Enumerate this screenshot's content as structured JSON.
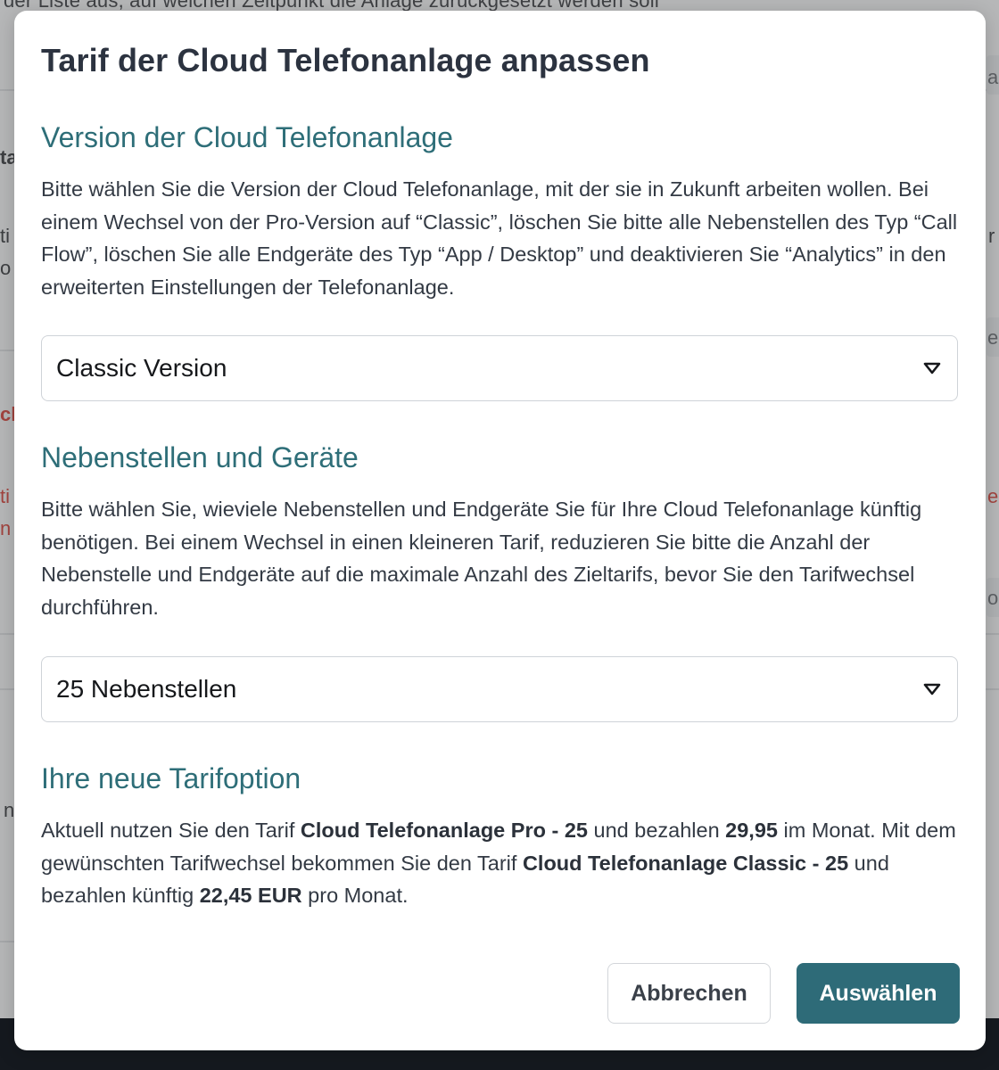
{
  "background": {
    "top_text": "der Liste aus, auf welchen Zeitpunkt die Anlage zurückgesetzt werden soll",
    "left_fragments": [
      "ta",
      "ti",
      "o",
      "ck",
      "ti",
      "n",
      "n"
    ],
    "right_fragments": [
      "a",
      "r",
      "e",
      "e",
      "o"
    ]
  },
  "modal": {
    "title": "Tarif der Cloud Telefonanlage anpassen",
    "version_section": {
      "heading": "Version der Cloud Telefonanlage",
      "text": "Bitte wählen Sie die Version der Cloud Telefonanlage, mit der sie in Zukunft arbeiten wollen. Bei einem Wechsel von der Pro-Version auf “Classic”, löschen Sie bitte alle Nebenstellen des Typ “Call Flow”, löschen Sie alle Endgeräte des Typ “App / Desktop” und deaktivieren Sie “Analytics” in den erweiterten Einstellungen der Telefonanlage.",
      "selected": "Classic Version"
    },
    "extensions_section": {
      "heading": "Nebenstellen und Geräte",
      "text": "Bitte wählen Sie, wieviele Nebenstellen und Endgeräte Sie für Ihre Cloud Telefonanlage künftig benötigen. Bei einem Wechsel in einen kleineren Tarif, reduzieren Sie bitte die Anzahl der Nebenstelle und Endgeräte auf die maximale Anzahl des Zieltarifs, bevor Sie den Tarifwechsel durchführen.",
      "selected": "25 Nebenstellen"
    },
    "tariff_section": {
      "heading": "Ihre neue Tarifoption",
      "t1": "Aktuell nutzen Sie den Tarif ",
      "current_tariff": "Cloud Telefonanlage Pro - 25",
      "t2": " und bezahlen ",
      "current_price": "29,95",
      "t3": " im Monat. Mit dem gewünschten Tarifwechsel bekommen Sie den Tarif ",
      "new_tariff": "Cloud Telefonanlage Classic - 25",
      "t4": " und bezahlen künftig ",
      "new_price": "22,45 EUR",
      "t5": " pro Monat."
    },
    "buttons": {
      "cancel": "Abbrechen",
      "confirm": "Auswählen"
    }
  },
  "colors": {
    "accent": "#2e6b78",
    "heading": "#2e6e78",
    "title": "#2c3340"
  }
}
